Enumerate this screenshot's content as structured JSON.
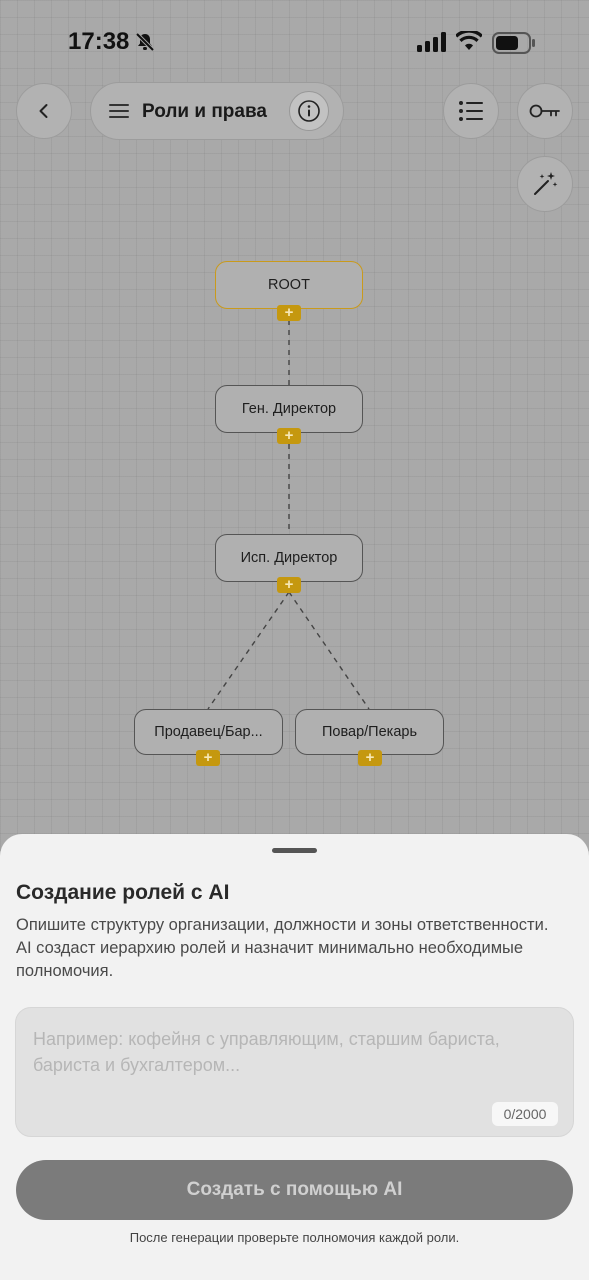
{
  "status_bar": {
    "time": "17:38",
    "bell": "bell-slash-icon",
    "signal": "cellular-signal-icon",
    "wifi": "wifi-icon",
    "battery": "battery-icon"
  },
  "header": {
    "back_icon": "chevron-left-icon",
    "menu_icon": "hamburger-menu-icon",
    "title": "Роли и права",
    "info_icon": "info-icon",
    "list_icon": "list-icon",
    "key_icon": "key-icon",
    "magic_icon": "magic-wand-icon"
  },
  "tree": {
    "nodes": [
      {
        "id": "root",
        "label": "ROOT",
        "highlighted": true
      },
      {
        "id": "gen-director",
        "label": "Ген. Директор",
        "parent": "root"
      },
      {
        "id": "exec-director",
        "label": "Исп. Директор",
        "parent": "gen-director"
      },
      {
        "id": "seller",
        "label": "Продавец/Бар...",
        "parent": "exec-director"
      },
      {
        "id": "cook",
        "label": "Повар/Пекарь",
        "parent": "exec-director"
      }
    ],
    "add_symbol": "+"
  },
  "sheet": {
    "title": "Создание ролей с AI",
    "description": "Опишите структуру организации, должности и зоны ответственности. AI создаст иерархию ролей и назначит минимально необходимые полномочия.",
    "input": {
      "value": "",
      "placeholder": "Например: кофейня с управляющим, старшим бариста, бариста и бухгалтером...",
      "counter": "0/2000"
    },
    "submit_label": "Создать с помощью AI",
    "hint": "После генерации проверьте полномочия каждой роли."
  },
  "colors": {
    "accent": "#c5980f",
    "button_disabled": "#7b7b7b",
    "overlay": "#a9a9a9"
  }
}
